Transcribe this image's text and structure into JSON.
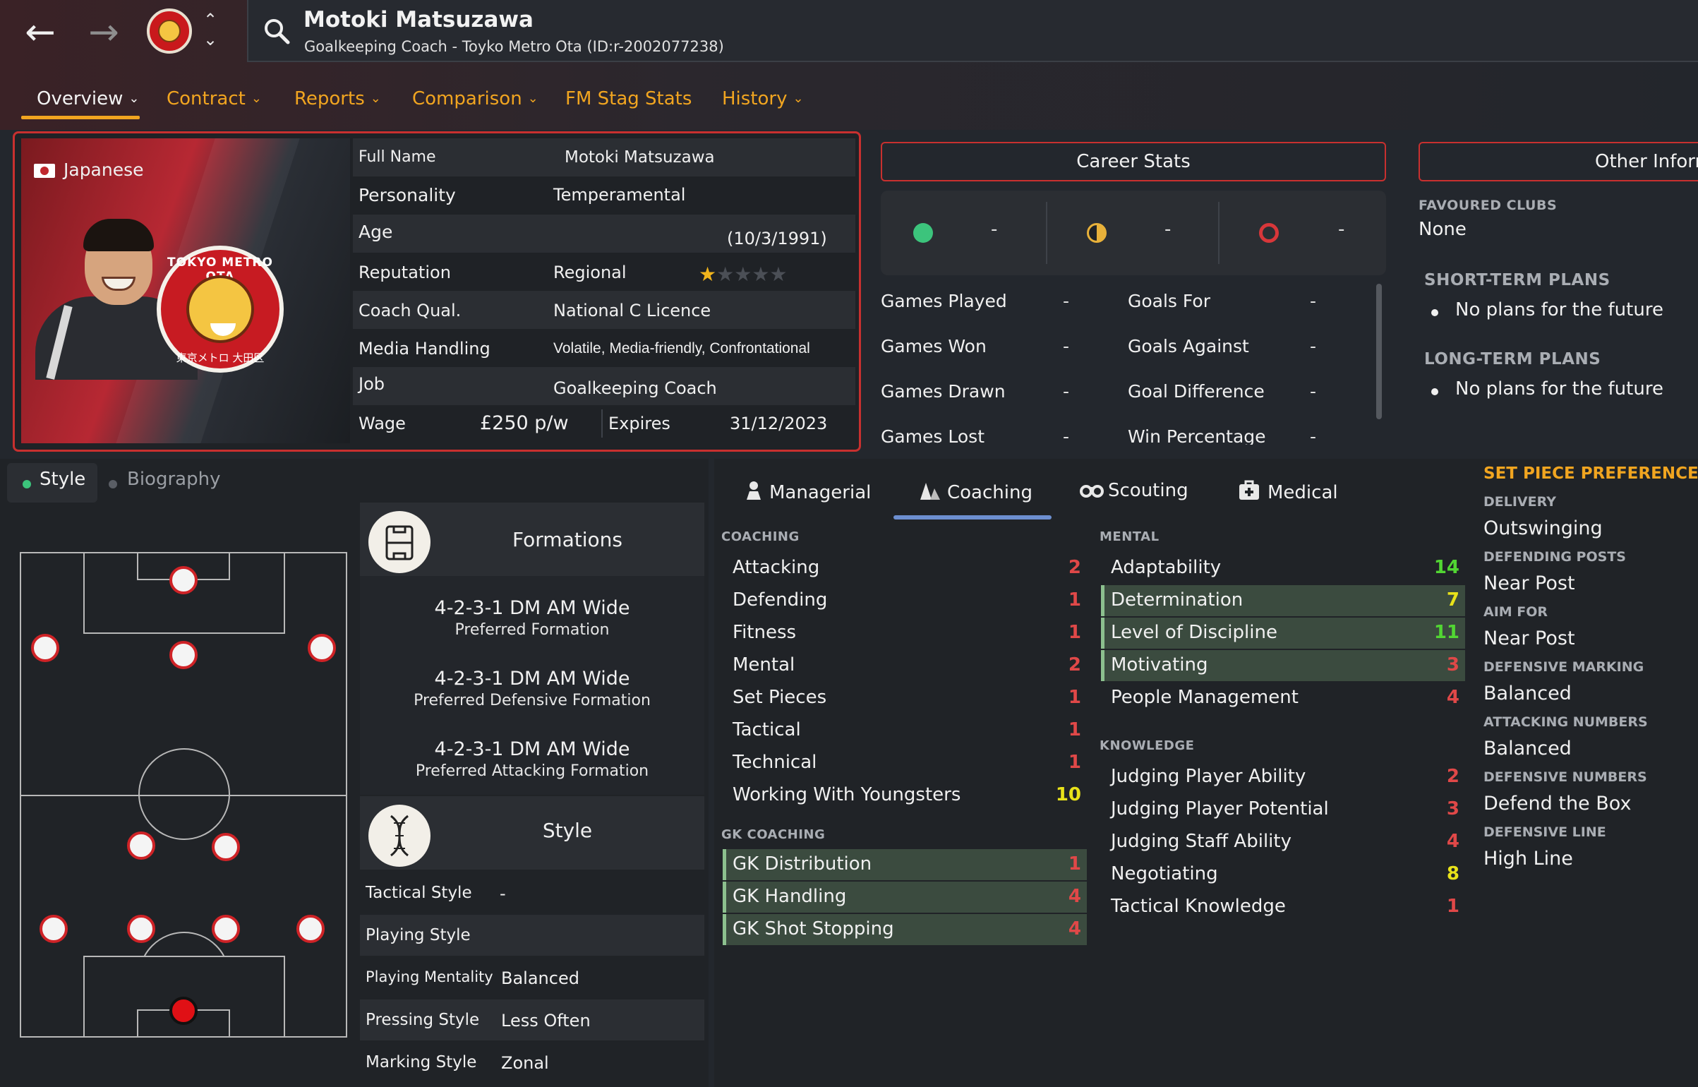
{
  "header": {
    "name": "Motoki Matsuzawa",
    "subtitle": "Goalkeeping Coach - Toyko Metro Ota (ID:r-2002077238)"
  },
  "tabs": [
    {
      "label": "Overview",
      "chevron": "⌄"
    },
    {
      "label": "Contract",
      "chevron": "⌄"
    },
    {
      "label": "Reports",
      "chevron": "⌄"
    },
    {
      "label": "Comparison",
      "chevron": "⌄"
    },
    {
      "label": "FM Stag Stats",
      "chevron": ""
    },
    {
      "label": "History",
      "chevron": "⌄"
    }
  ],
  "profile": {
    "nationality": "Japanese",
    "crest_text_top": "TOKYO METRO OTA",
    "crest_text_bottom": "東京メトロ 大田区",
    "rows": {
      "full_name": {
        "label": "Full Name",
        "value": "Motoki Matsuzawa"
      },
      "personality": {
        "label": "Personality",
        "value": "Temperamental"
      },
      "age": {
        "label": "Age",
        "value": "(10/3/1991)"
      },
      "reputation": {
        "label": "Reputation",
        "value": "Regional",
        "stars": 1,
        "max_stars": 5
      },
      "coach_qual": {
        "label": "Coach Qual.",
        "value": "National C Licence"
      },
      "media_handling": {
        "label": "Media Handling",
        "value": "Volatile, Media-friendly, Confrontational"
      },
      "job": {
        "label": "Job",
        "value": "Goalkeeping Coach"
      },
      "wage": {
        "label": "Wage",
        "value": "£250 p/w",
        "expires_label": "Expires",
        "expires_value": "31/12/2023"
      }
    }
  },
  "career_stats": {
    "title": "Career Stats",
    "results": [
      {
        "icon": "win-dot-icon",
        "color": "#3cc47c",
        "value": "-"
      },
      {
        "icon": "draw-half-icon",
        "color": "#e8b13a",
        "value": "-"
      },
      {
        "icon": "loss-ring-icon",
        "color": "#d8373a",
        "value": "-"
      }
    ],
    "rows": [
      {
        "left_label": "Games Played",
        "left_value": "-",
        "right_label": "Goals For",
        "right_value": "-"
      },
      {
        "left_label": "Games Won",
        "left_value": "-",
        "right_label": "Goals Against",
        "right_value": "-"
      },
      {
        "left_label": "Games Drawn",
        "left_value": "-",
        "right_label": "Goal Difference",
        "right_value": "-"
      },
      {
        "left_label": "Games Lost",
        "left_value": "-",
        "right_label": "Win Percentage",
        "right_value": "-"
      }
    ]
  },
  "other_info": {
    "title": "Other Inform",
    "favoured_clubs_label": "FAVOURED CLUBS",
    "favoured_clubs_value": "None",
    "short_term_label": "SHORT-TERM PLANS",
    "short_term_value": "No plans for the future",
    "long_term_label": "LONG-TERM PLANS",
    "long_term_value": "No plans for the future"
  },
  "style_tabs": {
    "style": "Style",
    "biography": "Biography"
  },
  "formations": {
    "title": "Formations",
    "items": [
      {
        "name": "4-2-3-1 DM AM Wide",
        "sub": "Preferred Formation"
      },
      {
        "name": "4-2-3-1 DM AM Wide",
        "sub": "Preferred Defensive Formation"
      },
      {
        "name": "4-2-3-1 DM AM Wide",
        "sub": "Preferred Attacking Formation"
      }
    ]
  },
  "style_card": {
    "title": "Style",
    "rows": [
      {
        "label": "Tactical Style",
        "value": "-"
      },
      {
        "label": "Playing Style",
        "value": ""
      },
      {
        "label": "Playing Mentality",
        "value": "Balanced"
      },
      {
        "label": "Pressing Style",
        "value": "Less Often"
      },
      {
        "label": "Marking Style",
        "value": "Zonal"
      }
    ]
  },
  "attr_tabs": [
    {
      "label": "Managerial",
      "icon": "managerial-icon"
    },
    {
      "label": "Coaching",
      "icon": "coaching-icon"
    },
    {
      "label": "Scouting",
      "icon": "binoculars-icon"
    },
    {
      "label": "Medical",
      "icon": "medical-kit-icon"
    }
  ],
  "coaching": {
    "heading": "COACHING",
    "items": [
      {
        "name": "Attacking",
        "value": "2"
      },
      {
        "name": "Defending",
        "value": "1"
      },
      {
        "name": "Fitness",
        "value": "1"
      },
      {
        "name": "Mental",
        "value": "2"
      },
      {
        "name": "Set Pieces",
        "value": "1"
      },
      {
        "name": "Tactical",
        "value": "1"
      },
      {
        "name": "Technical",
        "value": "1"
      },
      {
        "name": "Working With Youngsters",
        "value": "10"
      }
    ]
  },
  "gk_coaching": {
    "heading": "GK COACHING",
    "items": [
      {
        "name": "GK Distribution",
        "value": "1"
      },
      {
        "name": "GK Handling",
        "value": "4"
      },
      {
        "name": "GK Shot Stopping",
        "value": "4"
      }
    ]
  },
  "mental": {
    "heading": "MENTAL",
    "items": [
      {
        "name": "Adaptability",
        "value": "14"
      },
      {
        "name": "Determination",
        "value": "7"
      },
      {
        "name": "Level of Discipline",
        "value": "11"
      },
      {
        "name": "Motivating",
        "value": "3"
      },
      {
        "name": "People Management",
        "value": "4"
      }
    ]
  },
  "knowledge": {
    "heading": "KNOWLEDGE",
    "items": [
      {
        "name": "Judging Player Ability",
        "value": "2"
      },
      {
        "name": "Judging Player Potential",
        "value": "3"
      },
      {
        "name": "Judging Staff Ability",
        "value": "4"
      },
      {
        "name": "Negotiating",
        "value": "8"
      },
      {
        "name": "Tactical Knowledge",
        "value": "1"
      }
    ]
  },
  "set_pieces": {
    "title": "SET PIECE PREFERENCES",
    "items": [
      {
        "label": "DELIVERY",
        "value": "Outswinging"
      },
      {
        "label": "DEFENDING POSTS",
        "value": "Near Post"
      },
      {
        "label": "AIM FOR",
        "value": "Near Post"
      },
      {
        "label": "DEFENSIVE MARKING",
        "value": "Balanced"
      },
      {
        "label": "ATTACKING NUMBERS",
        "value": "Balanced"
      },
      {
        "label": "DEFENSIVE NUMBERS",
        "value": "Defend the Box"
      },
      {
        "label": "DEFENSIVE LINE",
        "value": "High Line"
      }
    ]
  },
  "colors": {
    "accent": "#f1a520",
    "card_border": "#c8302f",
    "low_attr": "#e04848",
    "mid_attr": "#e8e21a",
    "high_attr": "#52d633"
  }
}
